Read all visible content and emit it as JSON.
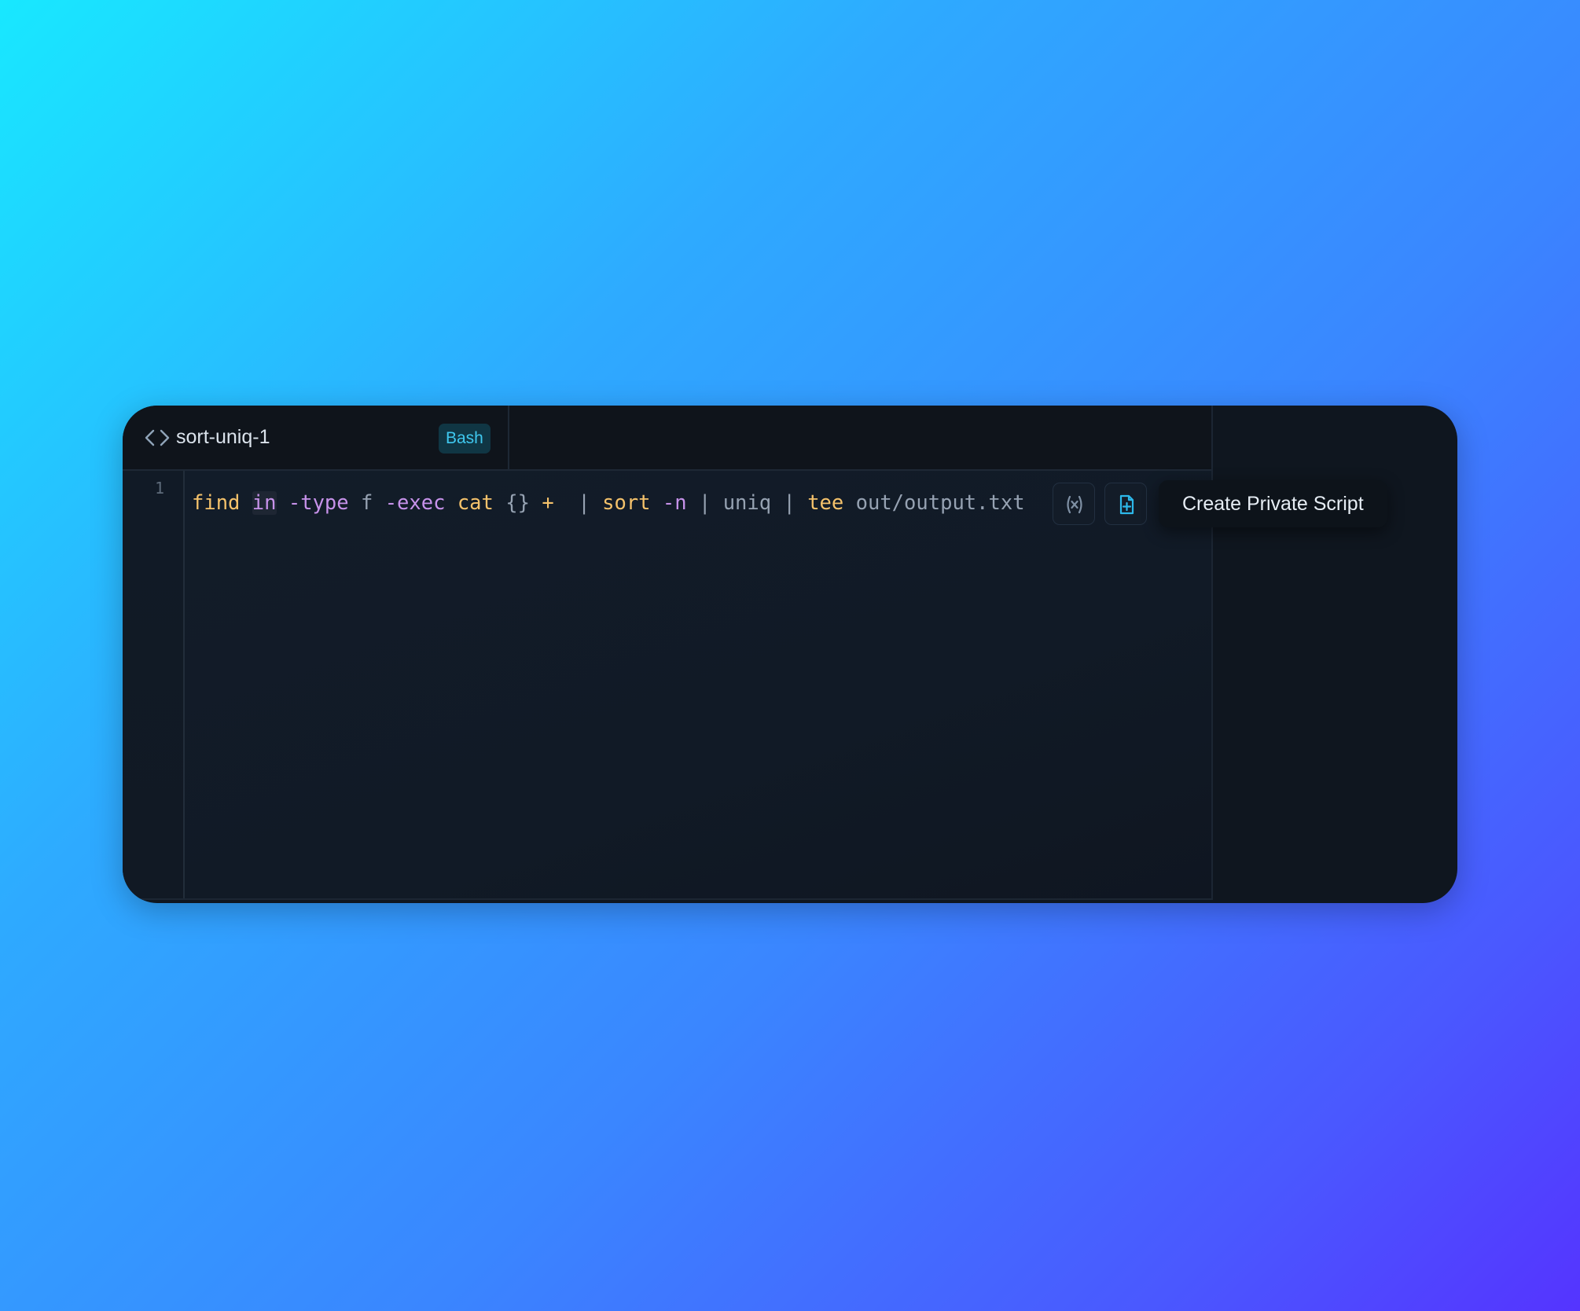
{
  "tab": {
    "title": "sort-uniq-1",
    "language": "Bash"
  },
  "editor": {
    "line_number": "1",
    "tokens": {
      "t1": "find",
      "t2": "in",
      "t3": "-type",
      "t4": "f",
      "t5": "-exec",
      "t6": "cat",
      "t7": "{}",
      "t8": "+",
      "t9": "|",
      "t10": "sort",
      "t11": "-n",
      "t12": "|",
      "t13": "uniq",
      "t14": "|",
      "t15": "tee",
      "t16": "out/output.txt"
    }
  },
  "actions": {
    "variables_icon": "variables-icon",
    "create_file_icon": "file-plus-icon",
    "tooltip": "Create Private Script"
  },
  "colors": {
    "command": "#f5c26b",
    "keyword": "#c792ea",
    "plain": "#96a2b2",
    "accent": "#3fc8ef"
  }
}
